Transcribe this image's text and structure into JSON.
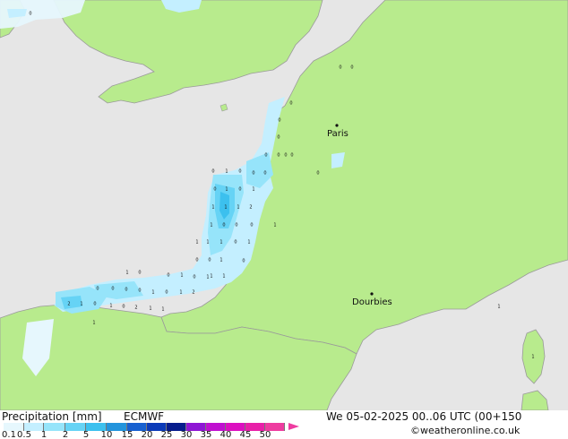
{
  "legend": {
    "title": "Precipitation [mm]",
    "model": "ECMWF",
    "valid": "We 05-02-2025 00..06 UTC (00+150",
    "credit": "©weatheronline.co.uk",
    "scale": [
      {
        "label": "0.1",
        "color": "#e6f7fd"
      },
      {
        "label": "0.5",
        "color": "#c4efff"
      },
      {
        "label": "1",
        "color": "#96e4fa"
      },
      {
        "label": "2",
        "color": "#66d3f5"
      },
      {
        "label": "5",
        "color": "#3cc0ee"
      },
      {
        "label": "10",
        "color": "#2294dc"
      },
      {
        "label": "15",
        "color": "#1760d0"
      },
      {
        "label": "20",
        "color": "#0b3ab8"
      },
      {
        "label": "25",
        "color": "#071c8c"
      },
      {
        "label": "30",
        "color": "#8e16d4"
      },
      {
        "label": "35",
        "color": "#c010d0"
      },
      {
        "label": "40",
        "color": "#dc10c0"
      },
      {
        "label": "45",
        "color": "#e820a8"
      },
      {
        "label": "50",
        "color": "#ee3ca0"
      }
    ]
  },
  "cities": [
    {
      "name": "Paris"
    },
    {
      "name": "Dourbies"
    }
  ],
  "colors": {
    "sea": "#e6e6e6",
    "land": "#b8eb8d",
    "coast": "#9a9a9a"
  },
  "point_values": [
    "0",
    "0",
    "0",
    "0",
    "0",
    "0",
    "0",
    "0",
    "0",
    "0",
    "0",
    "1",
    "0",
    "0",
    "0",
    "0",
    "1",
    "0",
    "1",
    "1",
    "1",
    "1",
    "2",
    "1",
    "0",
    "0",
    "0",
    "1",
    "1",
    "1",
    "0",
    "1",
    "0",
    "0",
    "1",
    "1",
    "1",
    "1",
    "0",
    "0",
    "1",
    "0",
    "1",
    "0",
    "0",
    "0",
    "0",
    "1",
    "0",
    "1",
    "2",
    "2",
    "1",
    "0",
    "1",
    "0",
    "2",
    "1",
    "1",
    "1",
    "1",
    "1",
    "1",
    "0",
    "0"
  ]
}
